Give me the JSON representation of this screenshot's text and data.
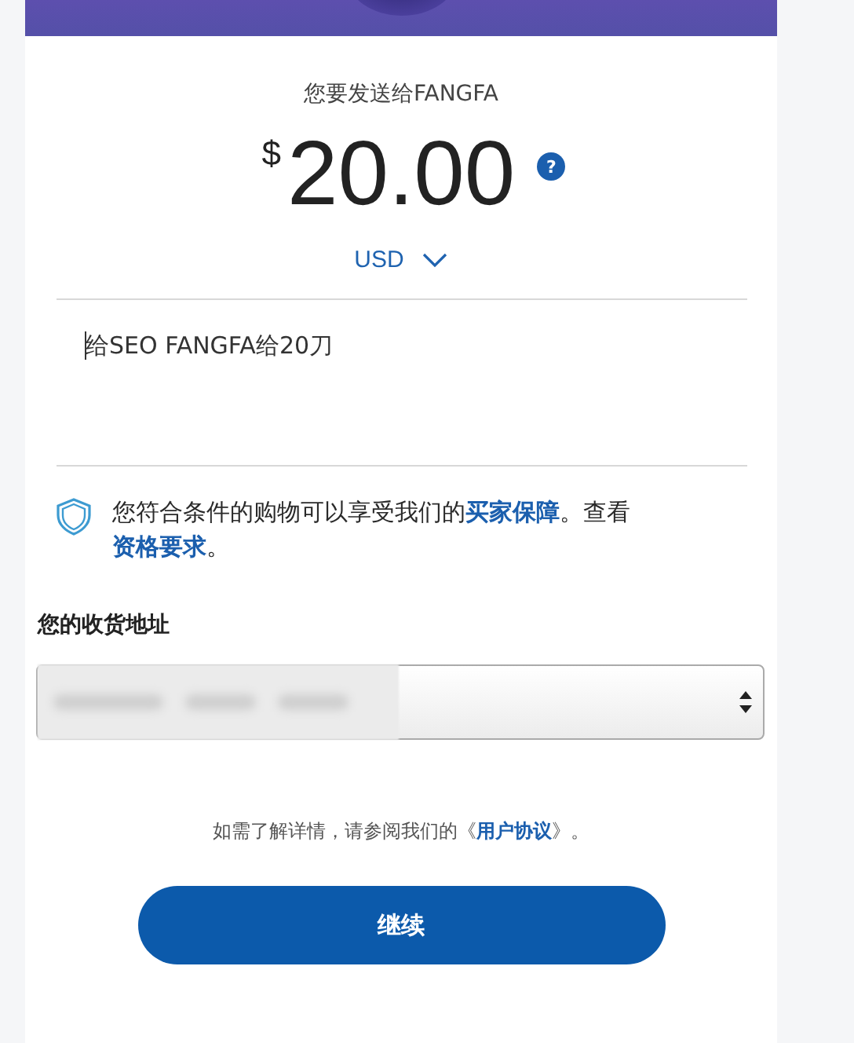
{
  "header": {
    "kind": "banner"
  },
  "recipient_line": "您要发送给FANGFA",
  "amount": {
    "currency_symbol": "$",
    "value": "20.00",
    "help": "?"
  },
  "currency": {
    "code": "USD"
  },
  "note": {
    "value": "给SEO FANGFA给20刀"
  },
  "protection": {
    "parts": [
      {
        "kind": "text",
        "text": "您符合条件的购物可以享受我们的"
      },
      {
        "kind": "link",
        "text": "买家保障"
      },
      {
        "kind": "text",
        "text": "。查看"
      },
      {
        "kind": "link",
        "text": "资格要求"
      },
      {
        "kind": "text",
        "text": "。"
      }
    ]
  },
  "shipping": {
    "label": "您的收货地址"
  },
  "agreement": {
    "parts": [
      {
        "kind": "text",
        "text": "如需了解详情，请参阅我们的《"
      },
      {
        "kind": "link",
        "text": "用户协议"
      },
      {
        "kind": "text",
        "text": "》。"
      }
    ]
  },
  "continue_button": "继续"
}
